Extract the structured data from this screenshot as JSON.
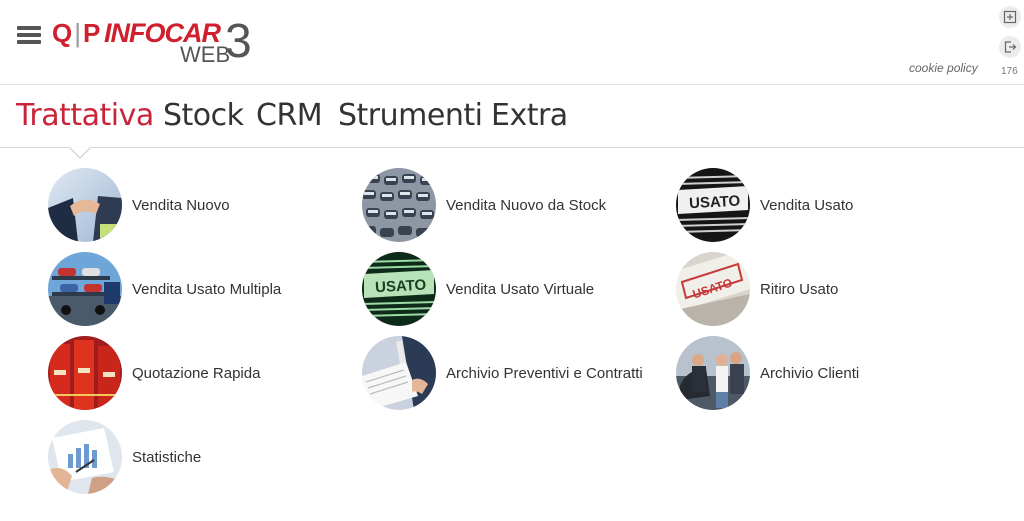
{
  "header": {
    "logo": {
      "qp_q": "Q",
      "qp_p": "P",
      "brand": "INFOCAR",
      "web": "WEB",
      "three": "3"
    },
    "cookie_policy": "cookie policy",
    "counter": "176"
  },
  "nav": {
    "tabs": [
      {
        "label": "Trattativa",
        "active": true
      },
      {
        "label": "Stock"
      },
      {
        "label": "CRM"
      },
      {
        "label": "Strumenti"
      },
      {
        "label": "Extra"
      }
    ]
  },
  "menu": {
    "items": [
      {
        "label": "Vendita Nuovo",
        "icon": "handshake-icon"
      },
      {
        "label": "Vendita Nuovo da Stock",
        "icon": "car-lot-icon"
      },
      {
        "label": "Vendita Usato",
        "icon": "usato-sign-icon"
      },
      {
        "label": "Vendita Usato Multipla",
        "icon": "car-transporter-icon"
      },
      {
        "label": "Vendita Usato Virtuale",
        "icon": "usato-virtual-sign-icon"
      },
      {
        "label": "Ritiro Usato",
        "icon": "usato-stamp-icon"
      },
      {
        "label": "Quotazione Rapida",
        "icon": "books-icon"
      },
      {
        "label": "Archivio Preventivi e Contratti",
        "icon": "documents-icon"
      },
      {
        "label": "Archivio Clienti",
        "icon": "customers-icon"
      },
      {
        "label": "Statistiche",
        "icon": "statistics-icon"
      }
    ]
  },
  "colors": {
    "accent": "#c9253a",
    "brand_red": "#d0202e",
    "text": "#333333"
  }
}
